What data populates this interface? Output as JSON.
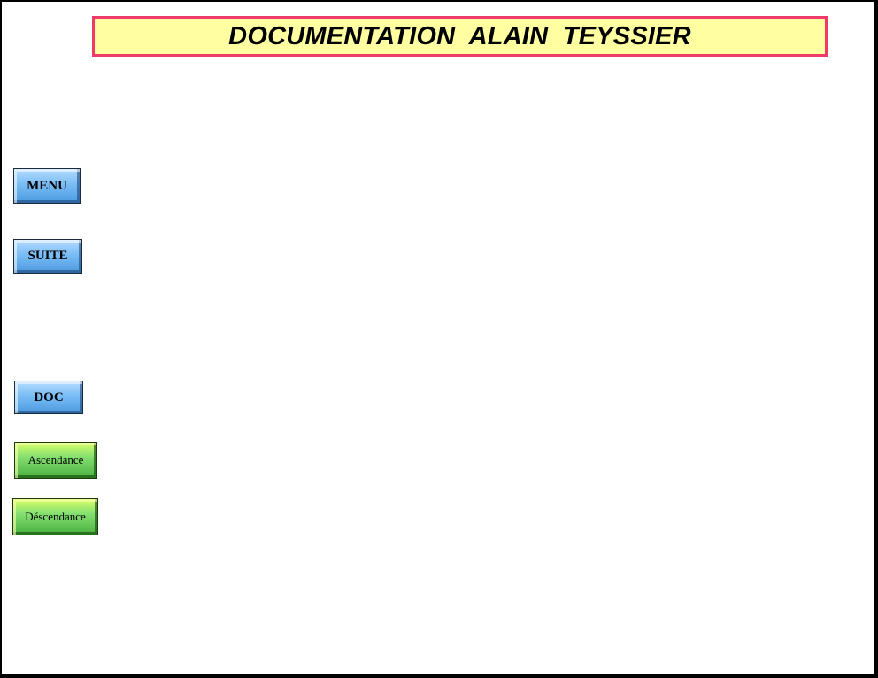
{
  "header": {
    "title": "DOCUMENTATION  ALAIN  TEYSSIER"
  },
  "nav": {
    "menu_label": "MENU",
    "suite_label": "SUITE",
    "doc_label": "DOC",
    "ascendance_label": "Ascendance",
    "descendance_label": "Déscendance"
  },
  "colors": {
    "title_background": "#ffffa2",
    "title_border": "#ee3b6a",
    "blue_button": "#79bdf6",
    "green_button": "#86e070"
  }
}
